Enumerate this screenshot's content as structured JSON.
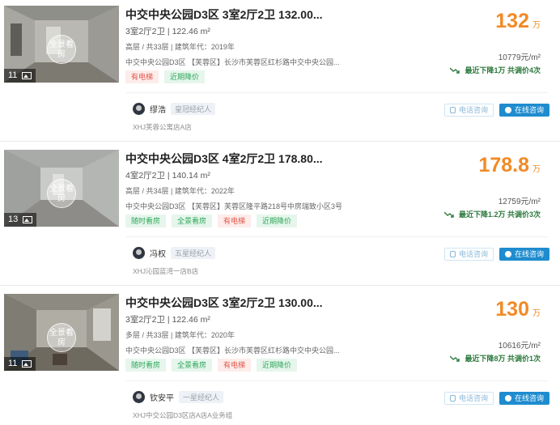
{
  "listings": [
    {
      "title": "中交中央公园D3区 3室2厅2卫 132.00...",
      "layout": "3室2厅2卫 | 122.46 m²",
      "floor_info": "高层 / 共33层 | 建筑年代：2019年",
      "address": "中交中央公园D3区 【芙蓉区】长沙市芙蓉区红杉路中交中央公园...",
      "tags": [
        "有电梯",
        "近期降价"
      ],
      "image_count": "11",
      "vr_label": "全景看房",
      "price": "132",
      "price_unit": "万",
      "unit_price": "10779元/m²",
      "price_drop": "最近下降1万  共调价4次",
      "agent_name": "缪浩",
      "agent_badge": "皇冠经纪人",
      "store": "XHJ芙蓉公寓店A店",
      "phone_label": "电话咨询",
      "chat_label": "在线咨询"
    },
    {
      "title": "中交中央公园D3区 4室2厅2卫 178.80...",
      "layout": "4室2厅2卫 | 140.14 m²",
      "floor_info": "高层 / 共34层 | 建筑年代：2022年",
      "address": "中交中央公园D3区 【芙蓉区】芙蓉区隆平路218号中房瑞致小区3号",
      "tags": [
        "随时看房",
        "全景看房",
        "有电梯",
        "近期降价"
      ],
      "image_count": "13",
      "vr_label": "全景看房",
      "price": "178.8",
      "price_unit": "万",
      "unit_price": "12759元/m²",
      "price_drop": "最近下降1.2万  共调价3次",
      "agent_name": "冯权",
      "agent_badge": "五星经纪人",
      "store": "XHJ沁园蓝湾一店B店",
      "phone_label": "电话咨询",
      "chat_label": "在线咨询"
    },
    {
      "title": "中交中央公园D3区 3室2厅2卫 130.00...",
      "layout": "3室2厅2卫 | 122.46 m²",
      "floor_info": "多层 / 共33层 | 建筑年代：2020年",
      "address": "中交中央公园D3区 【芙蓉区】长沙市芙蓉区红杉路中交中央公园...",
      "tags": [
        "随时看房",
        "全景看房",
        "有电梯",
        "近期降价"
      ],
      "image_count": "11",
      "vr_label": "全景看房",
      "price": "130",
      "price_unit": "万",
      "unit_price": "10616元/m²",
      "price_drop": "最近下降8万  共调价1次",
      "agent_name": "钦安平",
      "agent_badge": "一星经纪人",
      "store": "XHJ中交公园D3区店A店A业务组",
      "phone_label": "电话咨询",
      "chat_label": "在线咨询"
    }
  ],
  "tag_styles": {
    "有电梯": "red",
    "近期降价": "green",
    "随时看房": "green",
    "全景看房": "green"
  },
  "colors": {
    "price": "#f28a25",
    "chat_button": "#1f8ccf",
    "drop_text": "#2d7a3d"
  }
}
